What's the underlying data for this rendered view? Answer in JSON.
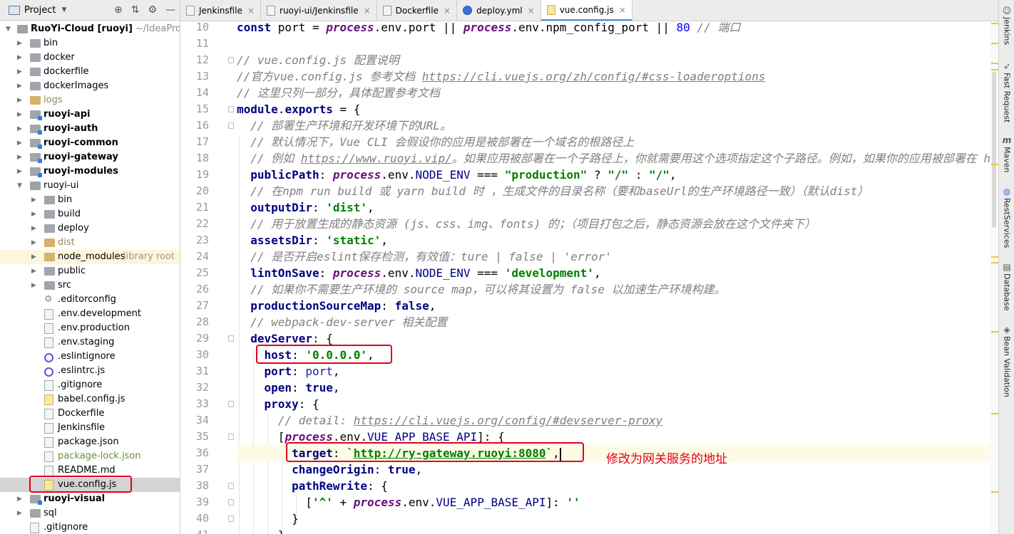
{
  "project_panel": {
    "title": "Project",
    "tools": [
      "crosshair-icon",
      "collapse-icon",
      "gear-icon",
      "minimize-icon"
    ],
    "root": {
      "name": "RuoYi-Cloud [ruoyi]",
      "path": "~/IdeaProjects/"
    },
    "tree": [
      {
        "label": "bin"
      },
      {
        "label": "docker"
      },
      {
        "label": "dockerfile"
      },
      {
        "label": "dockerImages"
      },
      {
        "label": "logs"
      },
      {
        "label": "ruoyi-api"
      },
      {
        "label": "ruoyi-auth"
      },
      {
        "label": "ruoyi-common"
      },
      {
        "label": "ruoyi-gateway"
      },
      {
        "label": "ruoyi-modules"
      },
      {
        "label": "ruoyi-ui"
      },
      {
        "label": "bin"
      },
      {
        "label": "build"
      },
      {
        "label": "deploy"
      },
      {
        "label": "dist"
      },
      {
        "label": "node_modules",
        "extra": "library root"
      },
      {
        "label": "public"
      },
      {
        "label": "src"
      },
      {
        "label": ".editorconfig"
      },
      {
        "label": ".env.development"
      },
      {
        "label": ".env.production"
      },
      {
        "label": ".env.staging"
      },
      {
        "label": ".eslintignore"
      },
      {
        "label": ".eslintrc.js"
      },
      {
        "label": ".gitignore"
      },
      {
        "label": "babel.config.js"
      },
      {
        "label": "Dockerfile"
      },
      {
        "label": "Jenkinsfile"
      },
      {
        "label": "package.json"
      },
      {
        "label": "package-lock.json"
      },
      {
        "label": "README.md"
      },
      {
        "label": "vue.config.js"
      },
      {
        "label": "ruoyi-visual"
      },
      {
        "label": "sql"
      },
      {
        "label": ".gitignore"
      }
    ]
  },
  "tabs": [
    {
      "label": "Jenkinsfile"
    },
    {
      "label": "ruoyi-ui/Jenkinsfile"
    },
    {
      "label": "Dockerfile"
    },
    {
      "label": "deploy.yml"
    },
    {
      "label": "vue.config.js",
      "active": true
    }
  ],
  "editor": {
    "line_numbers": [
      "10",
      "11",
      "12",
      "13",
      "14",
      "15",
      "16",
      "17",
      "18",
      "19",
      "20",
      "21",
      "22",
      "23",
      "24",
      "25",
      "26",
      "27",
      "28",
      "29",
      "30",
      "31",
      "32",
      "33",
      "34",
      "35",
      "36",
      "37",
      "38",
      "39",
      "40",
      "41"
    ],
    "t": {
      "l10_const": "const ",
      "l10_port": "port",
      "l10_eq": " = ",
      "l10_proc1": "process",
      "l10_envport": ".env.port || ",
      "l10_proc2": "process",
      "l10_envnpm": ".env.npm_config_port || ",
      "l10_num": "80",
      "l10_cm": " // 端口",
      "l12": "// vue.config.js 配置说明",
      "l13_a": "//官方vue.config.js 参考文档 ",
      "l13_link": "https://cli.vuejs.org/zh/config/#css-loaderoptions",
      "l14": "// 这里只列一部分，具体配置参考文档",
      "l15_kw": "module",
      "l15_b": ".",
      "l15_exp": "exports",
      "l15_c": " = {",
      "l16": "  // 部署生产环境和开发环境下的URL。",
      "l17": "  // 默认情况下，Vue CLI 会假设你的应用是被部署在一个域名的根路径上",
      "l18_a": "  // 例如 ",
      "l18_link": "https://www.ruoyi.vip/",
      "l18_b": "。如果应用被部署在一个子路径上，你就需要用这个选项指定这个子路径。例如，如果你的应用被部署在 h",
      "l19_key": "  publicPath",
      "l19_a": ": ",
      "l19_proc": "process",
      "l19_b": ".env.",
      "l19_env": "NODE_ENV",
      "l19_c": " === ",
      "l19_s1": "\"production\"",
      "l19_d": " ? ",
      "l19_s2": "\"/\"",
      "l19_e": " : ",
      "l19_s3": "\"/\"",
      "l19_f": ",",
      "l20": "  // 在npm run build 或 yarn build 时 ，生成文件的目录名称（要和baseUrl的生产环境路径一致）（默认dist）",
      "l21_key": "  outputDir",
      "l21_a": ": ",
      "l21_s": "'dist'",
      "l21_b": ",",
      "l22": "  // 用于放置生成的静态资源 (js、css、img、fonts) 的；（项目打包之后，静态资源会放在这个文件夹下）",
      "l23_key": "  assetsDir",
      "l23_a": ": ",
      "l23_s": "'static'",
      "l23_b": ",",
      "l24": "  // 是否开启eslint保存检测，有效值：ture | false | 'error'",
      "l25_key": "  lintOnSave",
      "l25_a": ": ",
      "l25_proc": "process",
      "l25_b": ".env.",
      "l25_env": "NODE_ENV",
      "l25_c": " === ",
      "l25_s": "'development'",
      "l25_d": ",",
      "l26": "  // 如果你不需要生产环境的 source map，可以将其设置为 false 以加速生产环境构建。",
      "l27_key": "  productionSourceMap",
      "l27_a": ": ",
      "l27_kw": "false",
      "l27_b": ",",
      "l28": "  // webpack-dev-server 相关配置",
      "l29_key": "  devServer",
      "l29_a": ": {",
      "l30_key": "    host",
      "l30_a": ": ",
      "l30_s": "'0.0.0.0'",
      "l30_b": ",",
      "l31_key": "    port",
      "l31_a": ": ",
      "l31_v": "port",
      "l31_b": ",",
      "l32_key": "    open",
      "l32_a": ": ",
      "l32_kw": "true",
      "l32_b": ",",
      "l33_key": "    proxy",
      "l33_a": ": {",
      "l34_a": "      // detail: ",
      "l34_link": "https://cli.vuejs.org/config/#devserver-proxy",
      "l35_a": "      [",
      "l35_proc": "process",
      "l35_b": ".env.",
      "l35_env": "VUE_APP_BASE_API",
      "l35_c": "]: {",
      "l36_key": "        target",
      "l36_a": ": ",
      "l36_q1": "`",
      "l36_link": "http://ry-gateway.ruoyi:8080",
      "l36_q2": "`",
      "l36_b": ",",
      "l37_key": "        changeOrigin",
      "l37_a": ": ",
      "l37_kw": "true",
      "l37_b": ",",
      "l38_key": "        pathRewrite",
      "l38_a": ": {",
      "l39_a": "          [",
      "l39_s1": "'^'",
      "l39_b": " + ",
      "l39_proc": "process",
      "l39_c": ".env.",
      "l39_env": "VUE_APP_BASE_API",
      "l39_d": "]: ",
      "l39_s2": "''",
      "l40": "        }",
      "l41": "      }"
    }
  },
  "annotation": "修改为网关服务的地址",
  "right_toolbar": [
    {
      "label": "Jenkins",
      "icon": "jenkins-icon"
    },
    {
      "label": "Fast Request",
      "icon": "rocket-icon"
    },
    {
      "label": "Maven",
      "icon": "maven-icon"
    },
    {
      "label": "RestServices",
      "icon": "globe-icon"
    },
    {
      "label": "Database",
      "icon": "database-icon"
    },
    {
      "label": "Bean Validation",
      "icon": "bean-icon"
    }
  ],
  "colors": {
    "highlight_box": "#e0001b",
    "keyword": "#000080",
    "string": "#008000",
    "comment": "#808080",
    "number": "#0000ff",
    "italic_global": "#660e7a"
  }
}
